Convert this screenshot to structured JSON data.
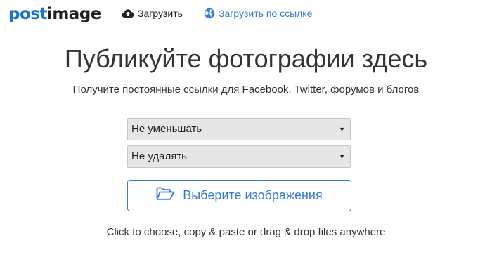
{
  "nav": {
    "logo_post": "post",
    "logo_image": "image",
    "upload_label": "Загрузить",
    "upload_icon": "cloud-upload-icon",
    "url_upload_label": "Загрузить по ссылке",
    "url_icon": "globe-icon"
  },
  "main": {
    "title": "Публикуйте фотографии здесь",
    "subtitle": "Получите постоянные ссылки для Facebook, Twitter, форумов и блогов",
    "resize_select": "Не уменьшать",
    "expire_select": "Не удалять",
    "choose_button": "Выберите изображения",
    "choose_icon": "folder-open-icon",
    "hint": "Click to choose, copy & paste or drag & drop files anywhere"
  },
  "colors": {
    "accent": "#3b7bd4",
    "logo_blue": "#1a73c7",
    "select_bg": "#e6e6e6"
  }
}
